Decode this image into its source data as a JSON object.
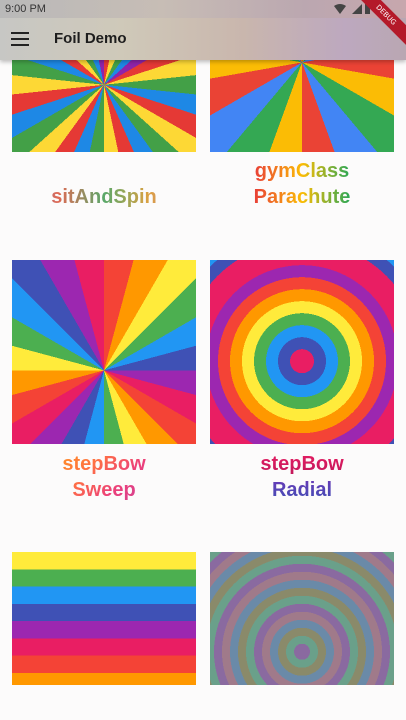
{
  "status_bar": {
    "time": "9:00 PM"
  },
  "app_bar": {
    "title": "Foil Demo",
    "debug_banner": "DEBUG"
  },
  "grid": {
    "items": [
      {
        "label_lines": [
          "sitAndSpin"
        ]
      },
      {
        "label_lines": [
          "gymClass",
          "Parachute"
        ]
      },
      {
        "label_lines": [
          "stepBow",
          "Sweep"
        ]
      },
      {
        "label_lines": [
          "stepBow",
          "Radial"
        ]
      }
    ]
  }
}
